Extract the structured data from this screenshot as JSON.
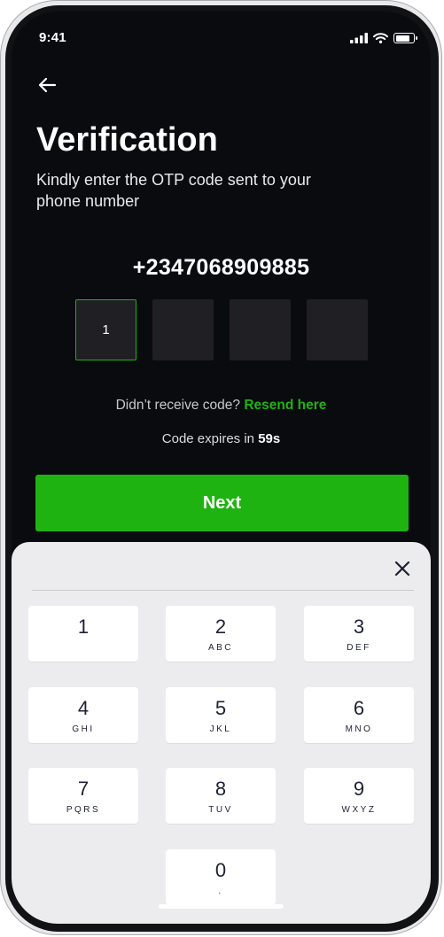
{
  "status_bar": {
    "time": "9:41"
  },
  "header": {
    "title": "Verification",
    "subtitle": "Kindly enter the OTP code sent to your phone number"
  },
  "phone_number": "+2347068909885",
  "otp": {
    "digits": [
      "1",
      "",
      "",
      ""
    ]
  },
  "resend": {
    "prompt": "Didn’t receive code? ",
    "link": "Resend here"
  },
  "expiry": {
    "prefix": "Code expires in ",
    "time": "59s"
  },
  "next_button": {
    "label": "Next"
  },
  "keypad": {
    "keys": [
      {
        "digit": "1",
        "letters": ""
      },
      {
        "digit": "2",
        "letters": "ABC"
      },
      {
        "digit": "3",
        "letters": "DEF"
      },
      {
        "digit": "4",
        "letters": "GHI"
      },
      {
        "digit": "5",
        "letters": "JKL"
      },
      {
        "digit": "6",
        "letters": "MNO"
      },
      {
        "digit": "7",
        "letters": "PQRS"
      },
      {
        "digit": "8",
        "letters": "TUV"
      },
      {
        "digit": "9",
        "letters": "WXYZ"
      },
      {
        "digit": "0",
        "letters": "."
      }
    ]
  },
  "colors": {
    "accent": "#1fb312",
    "background": "#0a0b0f",
    "otp_box": "#1f1f24",
    "keypad_background": "#ececee",
    "key_text": "#1d2034"
  },
  "icons": {
    "back": "arrow-left-icon",
    "close": "close-icon",
    "signal": "signal-icon",
    "wifi": "wifi-icon",
    "battery": "battery-icon"
  }
}
